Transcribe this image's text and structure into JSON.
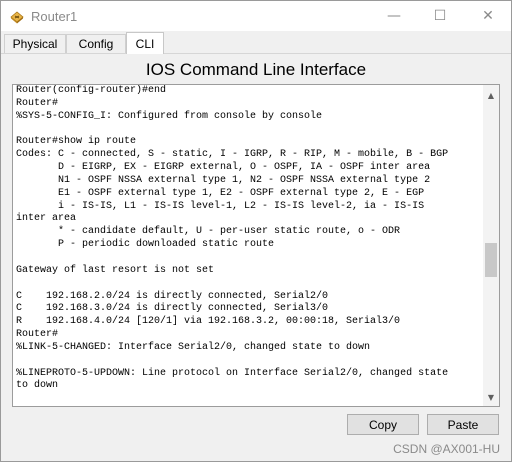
{
  "window": {
    "title": "Router1",
    "controls": {
      "minimize": "—",
      "maximize": "☐",
      "close": "✕"
    }
  },
  "tabs": [
    {
      "label": "Physical",
      "active": false
    },
    {
      "label": "Config",
      "active": false
    },
    {
      "label": "CLI",
      "active": true
    }
  ],
  "heading": "IOS Command Line Interface",
  "console_lines": [
    "Router(config-router)#end",
    "Router#",
    "%SYS-5-CONFIG_I: Configured from console by console",
    "",
    "Router#show ip route",
    "Codes: C - connected, S - static, I - IGRP, R - RIP, M - mobile, B - BGP",
    "       D - EIGRP, EX - EIGRP external, O - OSPF, IA - OSPF inter area",
    "       N1 - OSPF NSSA external type 1, N2 - OSPF NSSA external type 2",
    "       E1 - OSPF external type 1, E2 - OSPF external type 2, E - EGP",
    "       i - IS-IS, L1 - IS-IS level-1, L2 - IS-IS level-2, ia - IS-IS",
    "inter area",
    "       * - candidate default, U - per-user static route, o - ODR",
    "       P - periodic downloaded static route",
    "",
    "Gateway of last resort is not set",
    "",
    "C    192.168.2.0/24 is directly connected, Serial2/0",
    "C    192.168.3.0/24 is directly connected, Serial3/0",
    "R    192.168.4.0/24 [120/1] via 192.168.3.2, 00:00:18, Serial3/0",
    "Router#",
    "%LINK-5-CHANGED: Interface Serial2/0, changed state to down",
    "",
    "%LINEPROTO-5-UPDOWN: Line protocol on Interface Serial2/0, changed state",
    "to down",
    ""
  ],
  "buttons": {
    "copy": "Copy",
    "paste": "Paste"
  },
  "scrollbar": {
    "up": "▲",
    "down": "▼"
  },
  "watermark": "CSDN @AX001-HU"
}
